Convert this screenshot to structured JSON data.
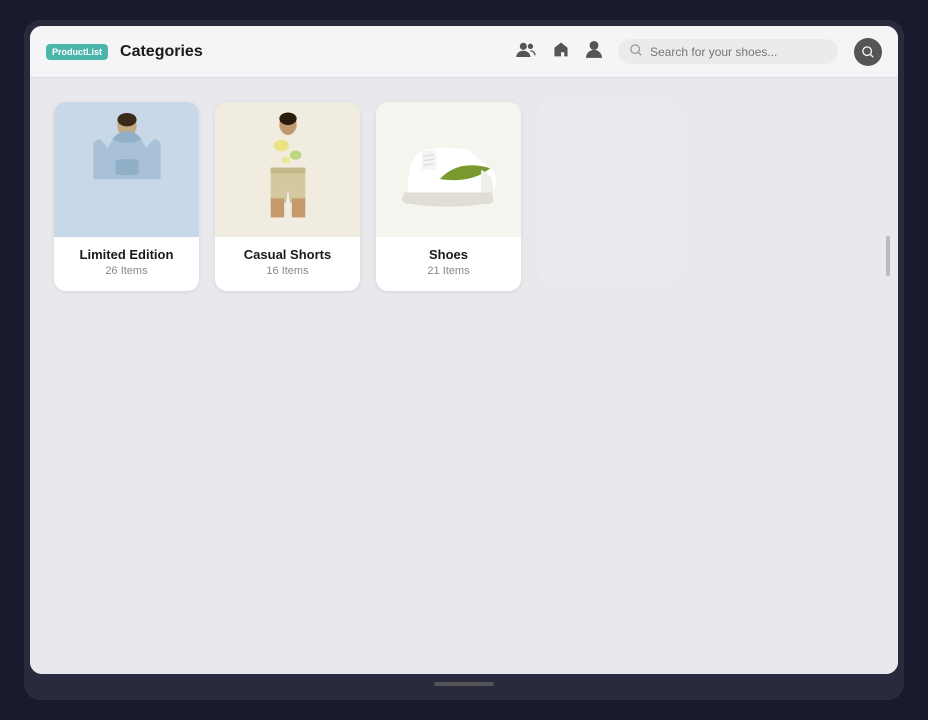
{
  "app": {
    "logo": "ProductList",
    "title": "Categories"
  },
  "header": {
    "search_placeholder": "Search for your shoes...",
    "icons": [
      "group-icon",
      "home-icon",
      "user-icon"
    ]
  },
  "categories": [
    {
      "id": "limited-edition",
      "name": "Limited Edition",
      "count": "26 Items",
      "bg_color": "#c8d8e8",
      "image_type": "hoodie"
    },
    {
      "id": "casual-shorts",
      "name": "Casual Shorts",
      "count": "16 Items",
      "bg_color": "#f0ede0",
      "image_type": "shorts"
    },
    {
      "id": "shoes",
      "name": "Shoes",
      "count": "21 Items",
      "bg_color": "#f5f5f0",
      "image_type": "shoe"
    }
  ]
}
